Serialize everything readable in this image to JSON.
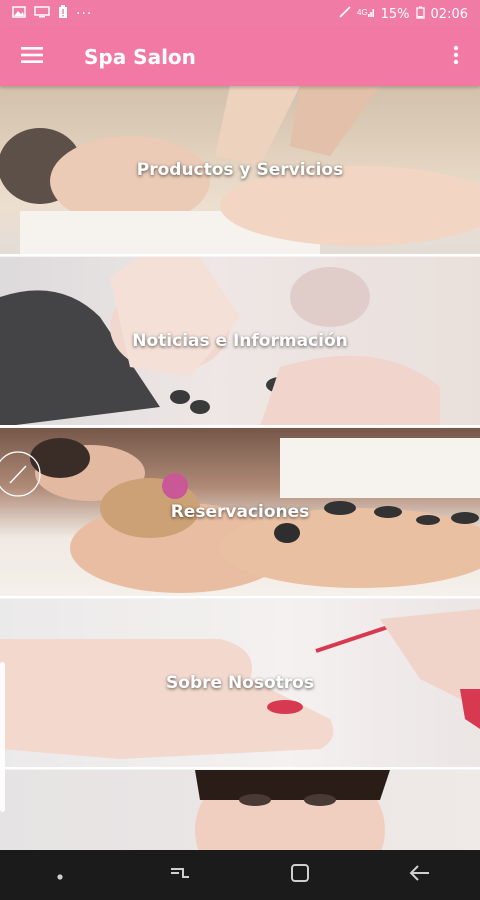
{
  "status_bar": {
    "battery": "15%",
    "time": "02:06",
    "dots": "···",
    "icons": [
      "image-icon",
      "screen-icon",
      "battery-alert-icon",
      "mute-icon",
      "signal-icon",
      "battery-icon"
    ]
  },
  "app_bar": {
    "title": "Spa Salon",
    "menu_icon": "hamburger-menu-icon",
    "overflow_icon": "more-vertical-icon"
  },
  "tiles": [
    {
      "label": "Productos y Servicios"
    },
    {
      "label": "Noticias e Información"
    },
    {
      "label": "Reservaciones"
    },
    {
      "label": "Sobre Nosotros"
    },
    {
      "label": ""
    }
  ],
  "colors": {
    "accent": "#f279a4",
    "status_bar": "#f07ca6",
    "nav_bar": "#1b1b1b"
  },
  "nav_bar": {
    "icons": [
      "dot-icon",
      "recents-icon",
      "home-icon",
      "back-icon"
    ]
  }
}
